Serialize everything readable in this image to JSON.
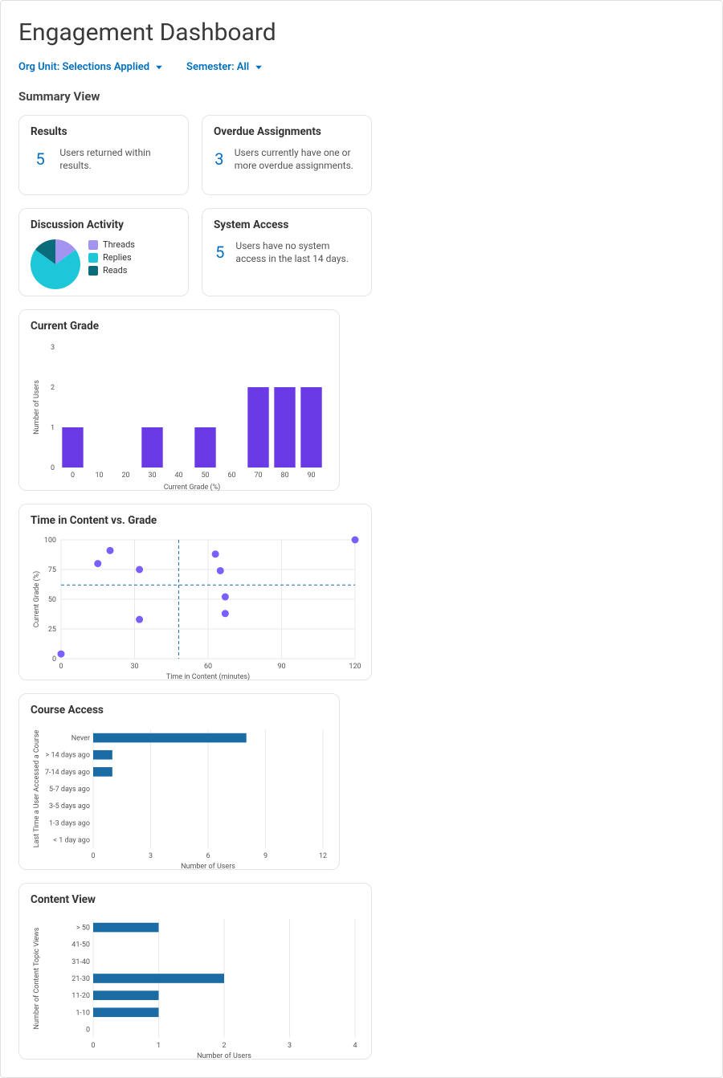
{
  "title": "Engagement Dashboard",
  "filters": {
    "org_unit": "Org Unit: Selections Applied",
    "semester": "Semester: All"
  },
  "section_title": "Summary View",
  "cards": {
    "results": {
      "title": "Results",
      "value": 5,
      "text": "Users returned within results."
    },
    "overdue": {
      "title": "Overdue Assignments",
      "value": 3,
      "text": "Users currently have one or more overdue assignments."
    },
    "system_access": {
      "title": "System Access",
      "value": 5,
      "text": "Users have no system access in the last 14 days."
    },
    "discussion": {
      "title": "Discussion Activity",
      "legend": {
        "threads": "Threads",
        "replies": "Replies",
        "reads": "Reads"
      },
      "colors": {
        "threads": "#a494f2",
        "replies": "#1ec7d8",
        "reads": "#0a6b7a"
      }
    },
    "current_grade": {
      "title": "Current Grade"
    },
    "tvg": {
      "title": "Time in Content vs. Grade"
    },
    "course_access": {
      "title": "Course Access"
    },
    "content_view": {
      "title": "Content View"
    }
  },
  "chart_data": {
    "discussion_pie": {
      "type": "pie",
      "series": [
        {
          "name": "Threads",
          "value": 15,
          "color": "#a494f2"
        },
        {
          "name": "Replies",
          "value": 70,
          "color": "#1ec7d8"
        },
        {
          "name": "Reads",
          "value": 15,
          "color": "#0a6b7a"
        }
      ]
    },
    "current_grade": {
      "type": "bar",
      "title": "Current Grade",
      "xlabel": "Current Grade (%)",
      "ylabel": "Number of Users",
      "x_ticks": [
        0,
        10,
        20,
        30,
        40,
        50,
        60,
        70,
        80,
        90
      ],
      "ylim": [
        0,
        3
      ],
      "y_ticks": [
        0,
        1,
        2,
        3
      ],
      "values": [
        1,
        0,
        0,
        1,
        0,
        1,
        0,
        2,
        2,
        2
      ],
      "color": "#6a3be4"
    },
    "time_vs_grade": {
      "type": "scatter",
      "title": "Time in Content vs. Grade",
      "xlabel": "Time in Content (minutes)",
      "ylabel": "Current Grade (%)",
      "xlim": [
        0,
        120
      ],
      "x_ticks": [
        0,
        30,
        60,
        90,
        120
      ],
      "ylim": [
        0,
        100
      ],
      "y_ticks": [
        0,
        25,
        50,
        75,
        100
      ],
      "points": [
        {
          "x": 0,
          "y": 4
        },
        {
          "x": 15,
          "y": 80
        },
        {
          "x": 20,
          "y": 91
        },
        {
          "x": 32,
          "y": 75
        },
        {
          "x": 32,
          "y": 33
        },
        {
          "x": 63,
          "y": 88
        },
        {
          "x": 65,
          "y": 74
        },
        {
          "x": 67,
          "y": 52
        },
        {
          "x": 67,
          "y": 38
        },
        {
          "x": 120,
          "y": 100
        }
      ],
      "reference_lines": {
        "x": 48,
        "y": 62
      },
      "color": "#7a5ffd"
    },
    "course_access": {
      "type": "bar",
      "orientation": "horizontal",
      "title": "Course Access",
      "xlabel": "Number of Users",
      "ylabel": "Last Time a User Accessed a Course",
      "categories": [
        "Never",
        "> 14 days ago",
        "7-14 days ago",
        "5-7 days ago",
        "3-5 days ago",
        "1-3 days ago",
        "< 1 day ago"
      ],
      "values": [
        8,
        1,
        1,
        0,
        0,
        0,
        0
      ],
      "xlim": [
        0,
        12
      ],
      "x_ticks": [
        0,
        3,
        6,
        9,
        12
      ],
      "color": "#1b6ba4"
    },
    "content_view": {
      "type": "bar",
      "orientation": "horizontal",
      "title": "Content View",
      "xlabel": "Number of Users",
      "ylabel": "Number of Content Topic Views",
      "categories": [
        "> 50",
        "41-50",
        "31-40",
        "21-30",
        "11-20",
        "1-10",
        "0"
      ],
      "values": [
        1,
        0,
        0,
        2,
        1,
        1,
        0
      ],
      "xlim": [
        0,
        4
      ],
      "x_ticks": [
        0,
        1,
        2,
        3,
        4
      ],
      "color": "#1b6ba4"
    }
  }
}
